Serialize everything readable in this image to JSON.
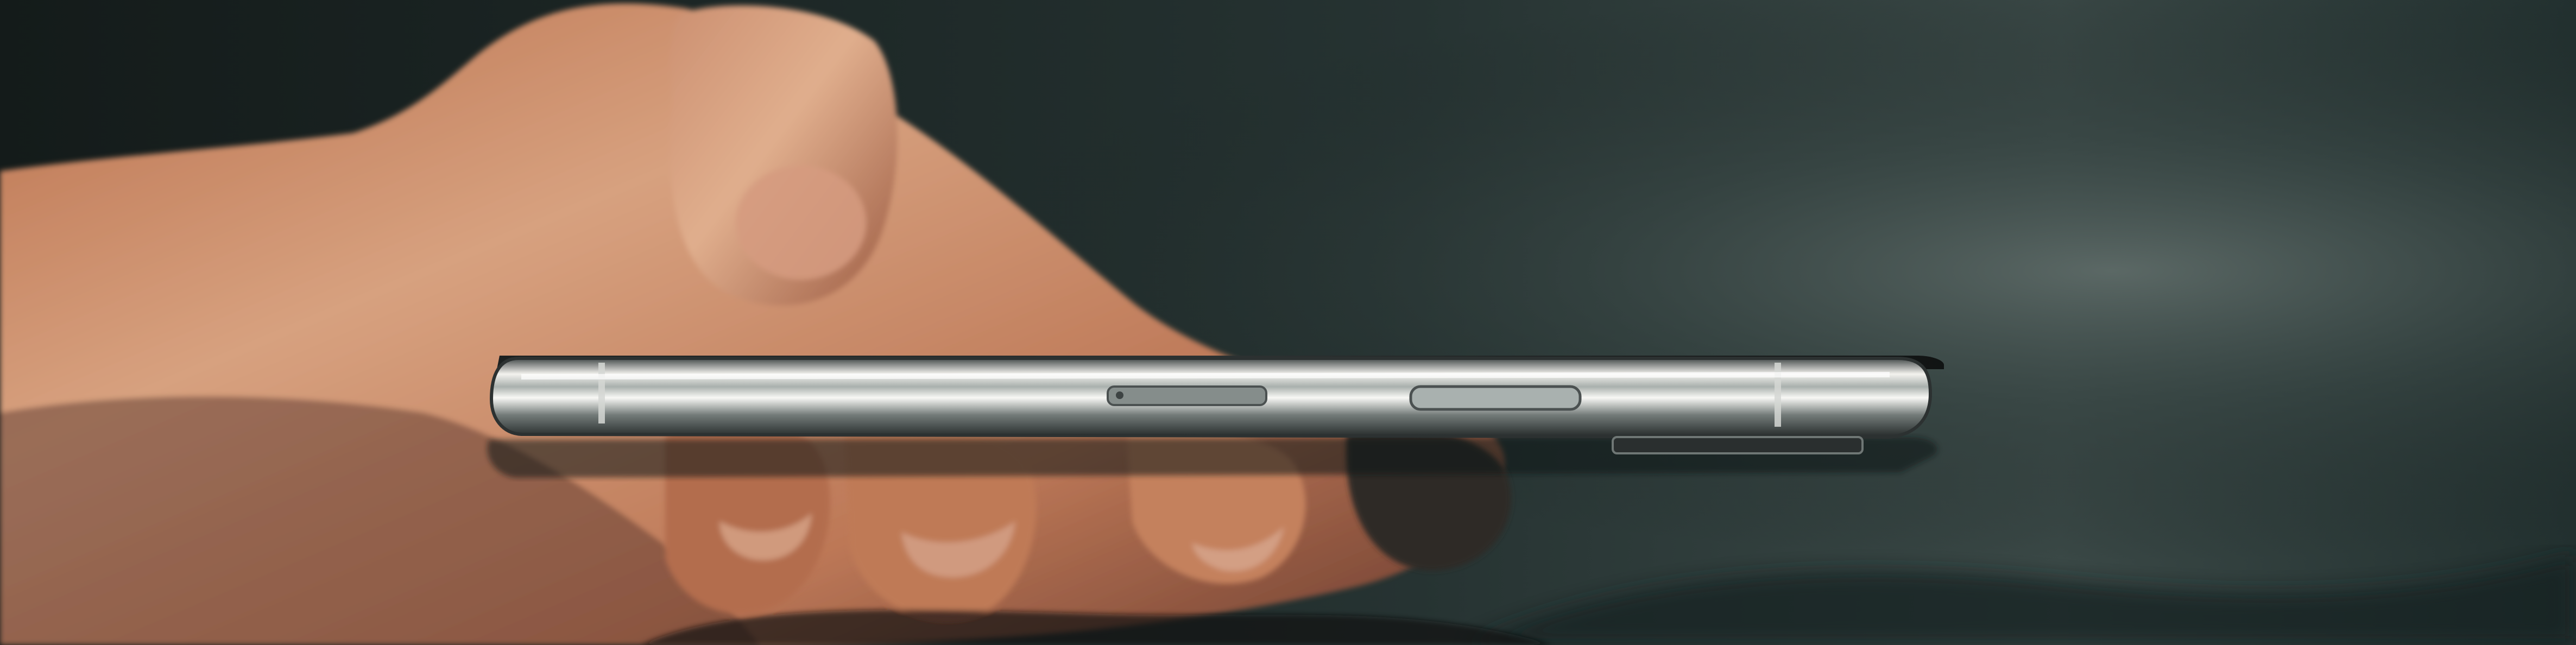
{
  "scene": {
    "subject": "hand-holding-phone-side-view",
    "colors": {
      "background_dark": "#151d1d",
      "background_mid": "#2a3836",
      "background_light": "#53605d",
      "skin_light": "#d8a27e",
      "skin_mid": "#b8714d",
      "skin_shadow": "#5f3427",
      "phone_highlight": "#f0f0ec",
      "phone_metal": "#8a918f",
      "phone_dark": "#2c3131"
    }
  }
}
